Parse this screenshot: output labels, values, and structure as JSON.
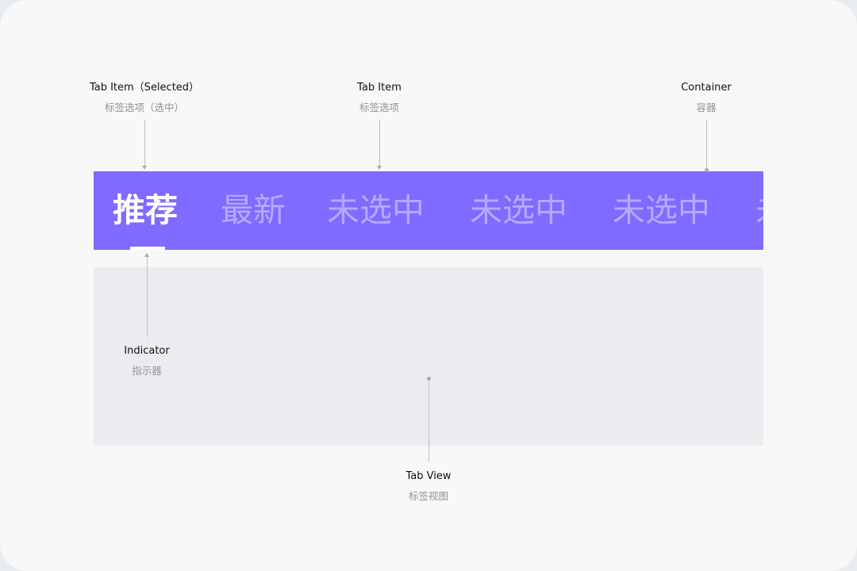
{
  "annotations": {
    "tab_item_selected": {
      "en": "Tab Item（Selected）",
      "zh": "标签选项（选中）"
    },
    "tab_item": {
      "en": "Tab Item",
      "zh": "标签选项"
    },
    "container": {
      "en": "Container",
      "zh": "容器"
    },
    "indicator": {
      "en": "Indicator",
      "zh": "指示器"
    },
    "tab_view": {
      "en": "Tab View",
      "zh": "标签视图"
    }
  },
  "tabs": [
    {
      "label": "推荐",
      "selected": true
    },
    {
      "label": "最新",
      "selected": false
    },
    {
      "label": "未选中",
      "selected": false
    },
    {
      "label": "未选中",
      "selected": false
    },
    {
      "label": "未选中",
      "selected": false
    },
    {
      "label": "未选中",
      "selected": false
    }
  ],
  "colors": {
    "tab_bar": "#7f6bff",
    "tab_view": "#ececf0",
    "indicator": "#ffffff",
    "selected_text": "#ffffff",
    "unselected_text": "rgba(255,255,255,0.42)"
  }
}
